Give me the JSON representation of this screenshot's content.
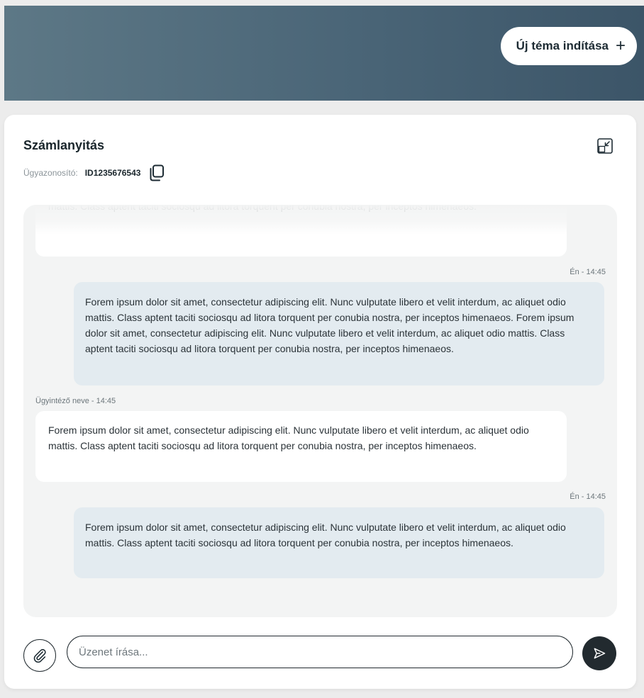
{
  "header": {
    "new_topic_label": "Új téma indítása",
    "new_topic_icon": "plus-icon"
  },
  "ticket": {
    "title": "Számlanyitás",
    "case_label": "Ügyazonosító:",
    "case_id": "ID1235676543",
    "copy_icon": "copy-icon",
    "collapse_icon": "collapse-icon"
  },
  "messages": [
    {
      "sender": "agent",
      "meta": "",
      "text": "Forem ipsum dolor sit amet, consectetur adipiscing elit. Nunc vulputate libero et velit interdum, ac aliquet odio mattis. Class aptent taciti sociosqu ad litora torquent per conubia nostra, per inceptos himenaeos."
    },
    {
      "sender": "me",
      "meta": "Én - 14:45",
      "text": "Forem ipsum dolor sit amet, consectetur adipiscing elit. Nunc vulputate libero et velit interdum, ac aliquet odio mattis. Class aptent taciti sociosqu ad litora torquent per conubia nostra, per inceptos himenaeos. Forem ipsum dolor sit amet, consectetur adipiscing elit. Nunc vulputate libero et velit interdum, ac aliquet odio mattis. Class aptent taciti sociosqu ad litora torquent per conubia nostra, per inceptos himenaeos."
    },
    {
      "sender": "agent",
      "meta": "Ügyintéző neve - 14:45",
      "text": "Forem ipsum dolor sit amet, consectetur adipiscing elit. Nunc vulputate libero et velit interdum, ac aliquet odio mattis. Class aptent taciti sociosqu ad litora torquent per conubia nostra, per inceptos himenaeos."
    },
    {
      "sender": "me",
      "meta": "Én - 14:45",
      "text": "Forem ipsum dolor sit amet, consectetur adipiscing elit. Nunc vulputate libero et velit interdum, ac aliquet odio mattis. Class aptent taciti sociosqu ad litora torquent per conubia nostra, per inceptos himenaeos."
    }
  ],
  "composer": {
    "placeholder": "Üzenet írása...",
    "value": "",
    "attach_icon": "paperclip-icon",
    "send_icon": "send-icon"
  },
  "colors": {
    "header_gradient_start": "#5d7886",
    "header_gradient_end": "#3c5568",
    "my_bubble": "#e3ebf0",
    "agent_bubble": "#ffffff",
    "chat_background": "#f3f4f4",
    "send_button": "#222a2f"
  }
}
